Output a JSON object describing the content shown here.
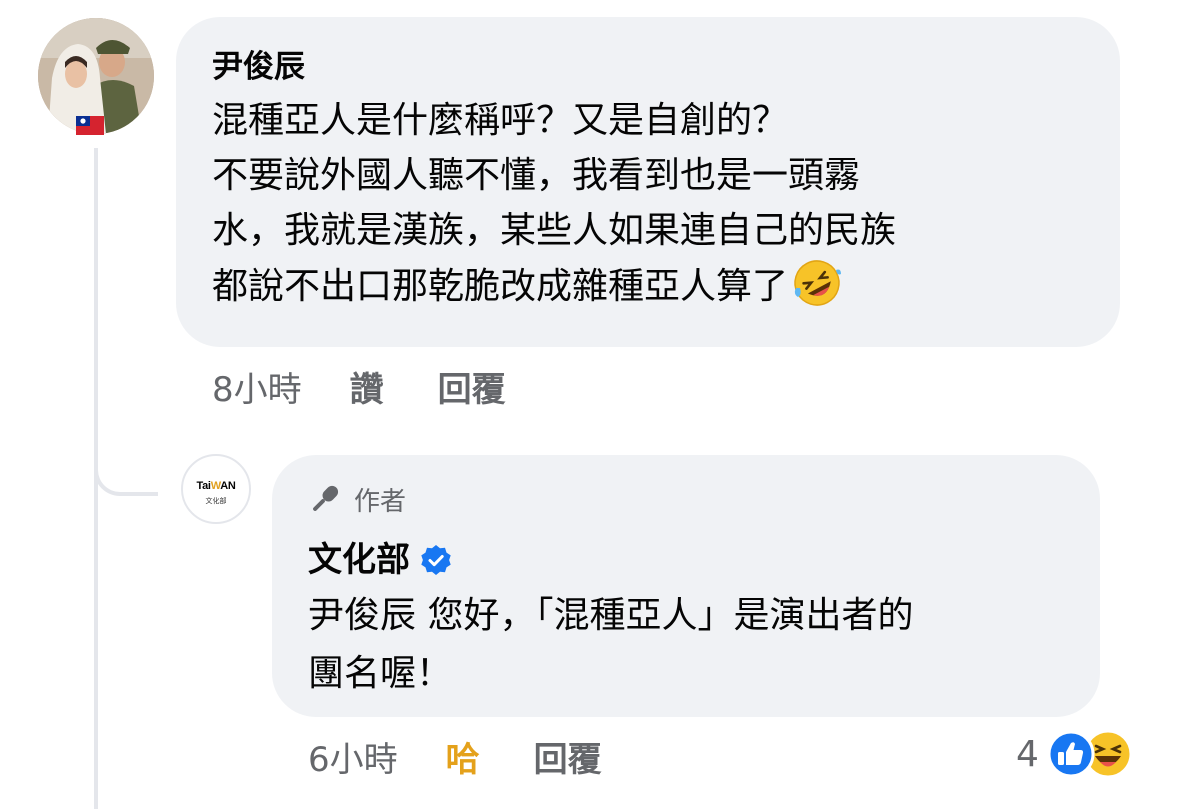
{
  "comment": {
    "author": "尹俊辰",
    "lines": [
      "混種亞人是什麼稱呼？又是自創的？",
      "不要說外國人聽不懂，我看到也是一頭霧",
      "水，我就是漢族，某些人如果連自己的民族",
      "都說不出口那乾脆改成雜種亞人算了"
    ],
    "emoji": "rolling-on-floor-laughing-emoji",
    "time": "8小時",
    "like_label": "讚",
    "reply_label": "回覆"
  },
  "reply": {
    "badge_label": "作者",
    "author": "文化部",
    "verified": true,
    "lines": [
      "尹俊辰 您好，「混種亞人」是演出者的",
      "團名喔！"
    ],
    "time": "6小時",
    "reaction_label": "哈",
    "reply_label": "回覆",
    "reaction_count": "4",
    "reaction_icons": [
      "like-icon",
      "haha-icon"
    ]
  },
  "logo": {
    "text_a": "Tai",
    "text_w": "W",
    "text_b": "AN",
    "sub": "文化部"
  },
  "colors": {
    "bubble": "#f0f2f5",
    "secondary_text": "#65676b",
    "haha_active": "#e4a11b",
    "like_blue": "#1877f2",
    "verified_blue": "#1877f2"
  }
}
